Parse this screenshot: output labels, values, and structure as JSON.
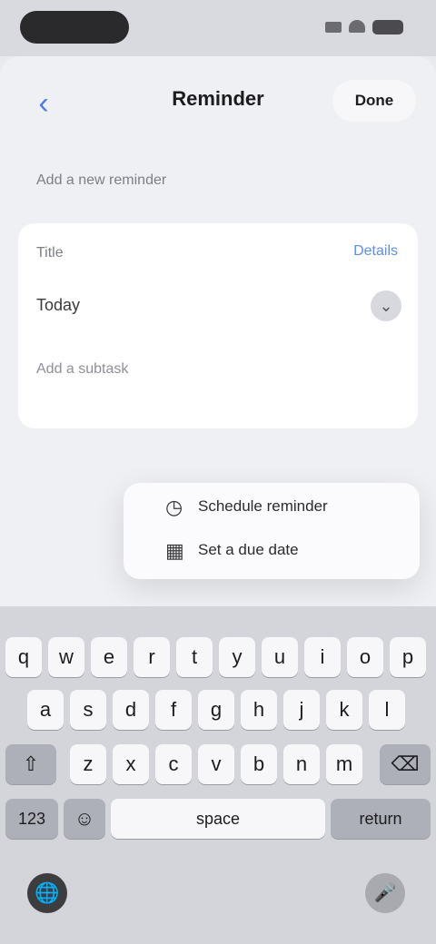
{
  "nav": {
    "back_icon": "chevron-left-icon",
    "back_glyph": "‹",
    "title": "Reminder",
    "action_label": "Done"
  },
  "section": {
    "label": "Add a new reminder"
  },
  "card": {
    "row1_label": "Title",
    "row1_link": "Details",
    "row2_label": "Today",
    "row2_chev": "⌄",
    "row3_label": "Add a subtask"
  },
  "menu": {
    "items": [
      {
        "icon": "clock-icon",
        "glyph": "◷",
        "label": "Schedule reminder"
      },
      {
        "icon": "calendar-icon",
        "glyph": "▦",
        "label": "Set a due date"
      }
    ]
  },
  "keyboard": {
    "row1": [
      "q",
      "w",
      "e",
      "r",
      "t",
      "y",
      "u",
      "i",
      "o",
      "p"
    ],
    "row2": [
      "a",
      "s",
      "d",
      "f",
      "g",
      "h",
      "j",
      "k",
      "l"
    ],
    "row3": [
      "⇧",
      "z",
      "x",
      "c",
      "v",
      "b",
      "n",
      "m",
      "⌫"
    ],
    "row4_left": "123",
    "row4_emoji": "☺",
    "row4_space": "space",
    "row4_return": "return",
    "globe_glyph": "🌐",
    "mic_glyph": "🎤"
  },
  "colors": {
    "accent": "#5d8ef0",
    "background": "#eff0f4",
    "keyboard": "#d3d5db"
  }
}
